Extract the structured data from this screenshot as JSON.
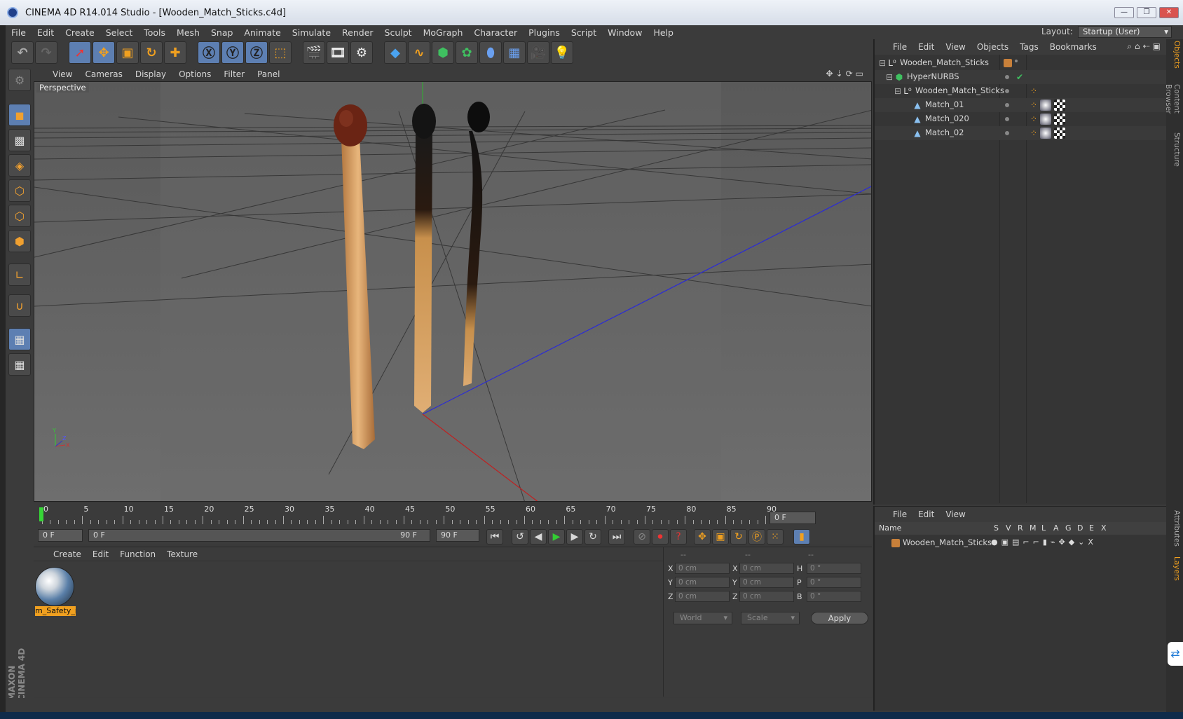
{
  "app": {
    "title": "CINEMA 4D R14.014 Studio - [Wooden_Match_Sticks.c4d]"
  },
  "window_controls": {
    "minimize": "—",
    "restore": "❐",
    "close": "✕"
  },
  "menu": [
    "File",
    "Edit",
    "Create",
    "Select",
    "Tools",
    "Mesh",
    "Snap",
    "Animate",
    "Simulate",
    "Render",
    "Sculpt",
    "MoGraph",
    "Character",
    "Plugins",
    "Script",
    "Window",
    "Help"
  ],
  "layout": {
    "label": "Layout:",
    "value": "Startup (User)"
  },
  "viewport": {
    "menu": [
      "View",
      "Cameras",
      "Display",
      "Options",
      "Filter",
      "Panel"
    ],
    "label": "Perspective",
    "axes": {
      "y": "Y",
      "x": "X",
      "z": "Z"
    }
  },
  "timeline": {
    "ticks": [
      "0",
      "5",
      "10",
      "15",
      "20",
      "25",
      "30",
      "35",
      "40",
      "45",
      "50",
      "55",
      "60",
      "65",
      "70",
      "75",
      "80",
      "85",
      "90"
    ],
    "current_frame_field": "0 F",
    "start_field": "0 F",
    "range_start": "0 F",
    "range_end": "90 F",
    "end_field": "90 F"
  },
  "material_panel": {
    "menu": [
      "Create",
      "Edit",
      "Function",
      "Texture"
    ],
    "materials": [
      {
        "name": "m_Safety_n"
      }
    ]
  },
  "coords": {
    "headers": [
      "--",
      "--",
      "--"
    ],
    "rows": [
      {
        "l1": "X",
        "v1": "0 cm",
        "l2": "X",
        "v2": "0 cm",
        "l3": "H",
        "v3": "0 °"
      },
      {
        "l1": "Y",
        "v1": "0 cm",
        "l2": "Y",
        "v2": "0 cm",
        "l3": "P",
        "v3": "0 °"
      },
      {
        "l1": "Z",
        "v1": "0 cm",
        "l2": "Z",
        "v2": "0 cm",
        "l3": "B",
        "v3": "0 °"
      }
    ],
    "mode": "World",
    "transform": "Scale",
    "apply": "Apply"
  },
  "object_manager": {
    "menu": [
      "File",
      "Edit",
      "View",
      "Objects",
      "Tags",
      "Bookmarks"
    ],
    "objects": [
      {
        "name": "Wooden_Match_Sticks",
        "depth": 0,
        "icon": "null-icon"
      },
      {
        "name": "HyperNURBS",
        "depth": 1,
        "icon": "hypernurbs-icon"
      },
      {
        "name": "Wooden_Match_Sticks",
        "depth": 2,
        "icon": "null-icon"
      },
      {
        "name": "Match_01",
        "depth": 3,
        "icon": "polygon-icon"
      },
      {
        "name": "Match_020",
        "depth": 3,
        "icon": "polygon-icon"
      },
      {
        "name": "Match_02",
        "depth": 3,
        "icon": "polygon-icon"
      }
    ]
  },
  "layer_manager": {
    "menu": [
      "File",
      "Edit",
      "View"
    ],
    "header": {
      "name": "Name",
      "cols": [
        "S",
        "V",
        "R",
        "M",
        "L",
        "A",
        "G",
        "D",
        "E",
        "X"
      ]
    },
    "layers": [
      {
        "name": "Wooden_Match_Sticks",
        "color": "#c8803a"
      }
    ]
  },
  "right_tabs": [
    "Objects",
    "Content Browser",
    "Structure",
    "Attributes",
    "Layers"
  ],
  "branding": {
    "text": "MAXON CINEMA 4D"
  },
  "colors": {
    "accent": "#f0a020",
    "selected": "#5d7fb2",
    "background": "#3b3b3b"
  }
}
